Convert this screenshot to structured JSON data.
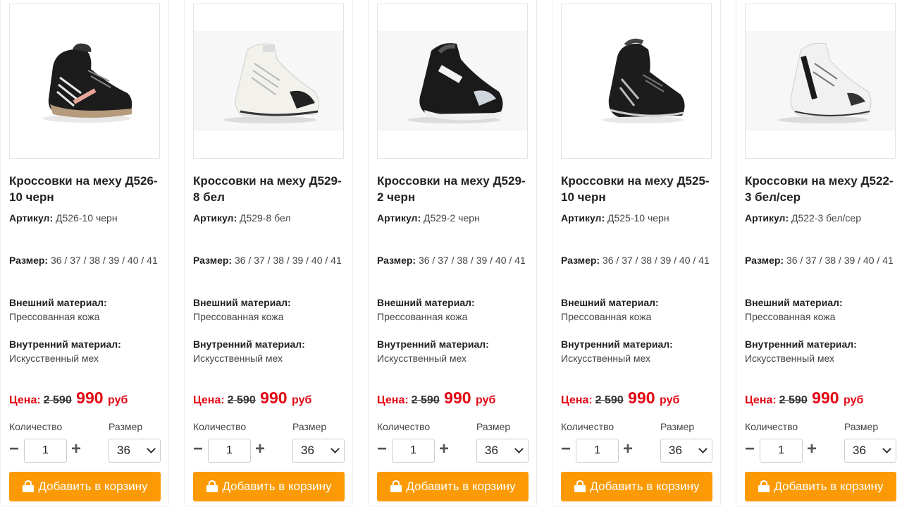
{
  "labels": {
    "sku": "Артикул:",
    "sizes": "Размер:",
    "outer": "Внешний материал:",
    "inner": "Внутренний материал:",
    "price": "Цена:",
    "quantity": "Количество",
    "size": "Размер",
    "add_to_cart": "Добавить в корзину",
    "currency": "руб"
  },
  "colors": {
    "accent": "#fc9a05",
    "price_red": "#e30613"
  },
  "products": [
    {
      "image": "black-winter-sneaker-photo",
      "title": "Кроссовки на меху Д526-10 черн",
      "sku": "Д526-10 черн",
      "sizes": "36 / 37 / 38 / 39 / 40 / 41",
      "outer": "Прессованная кожа",
      "inner": "Искусственный мех",
      "old_price": "2 590",
      "new_price": "990",
      "qty": "1",
      "size": "36"
    },
    {
      "image": "white-winter-sneaker-photo",
      "title": "Кроссовки на меху Д529-8 бел",
      "sku": "Д529-8 бел",
      "sizes": "36 / 37 / 38 / 39 / 40 / 41",
      "outer": "Прессованная кожа",
      "inner": "Искусственный мех",
      "old_price": "2 590",
      "new_price": "990",
      "qty": "1",
      "size": "36"
    },
    {
      "image": "black-white-winter-sneaker-photo",
      "title": "Кроссовки на меху Д529-2 черн",
      "sku": "Д529-2 черн",
      "sizes": "36 / 37 / 38 / 39 / 40 / 41",
      "outer": "Прессованная кожа",
      "inner": "Искусственный мех",
      "old_price": "2 590",
      "new_price": "990",
      "qty": "1",
      "size": "36"
    },
    {
      "image": "black-winter-sneaker-photo",
      "title": "Кроссовки на меху Д525-10 черн",
      "sku": "Д525-10 черн",
      "sizes": "36 / 37 / 38 / 39 / 40 / 41",
      "outer": "Прессованная кожа",
      "inner": "Искусственный мех",
      "old_price": "2 590",
      "new_price": "990",
      "qty": "1",
      "size": "36"
    },
    {
      "image": "white-grey-winter-sneaker-photo",
      "title": "Кроссовки на меху Д522-3 бел/сер",
      "sku": "Д522-3 бел/сер",
      "sizes": "36 / 37 / 38 / 39 / 40 / 41",
      "outer": "Прессованная кожа",
      "inner": "Искусственный мех",
      "old_price": "2 590",
      "new_price": "990",
      "qty": "1",
      "size": "36"
    }
  ]
}
